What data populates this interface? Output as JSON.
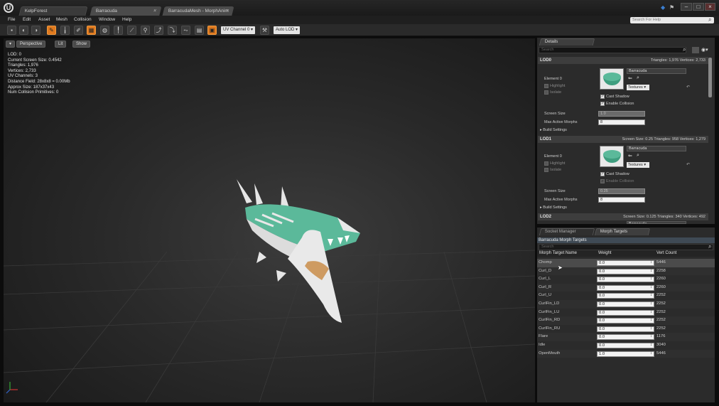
{
  "tabs": [
    {
      "label": "KelpForest"
    },
    {
      "label": "Barracuda"
    },
    {
      "label": "BarracudaMesh - MorphAnim"
    }
  ],
  "menu": [
    "File",
    "Edit",
    "Asset",
    "Mesh",
    "Collision",
    "Window",
    "Help"
  ],
  "search_help": {
    "placeholder": "Search For Help"
  },
  "toolbar": {
    "uv_channel": "UV Channel 0 ▾",
    "lod": "Auto LOD ▾"
  },
  "viewport": {
    "buttons": {
      "perspective": "Perspective",
      "lit": "Lit",
      "show": "Show"
    },
    "stats": [
      "LOD:  0",
      "Current Screen Size:  0.4542",
      "Triangles:  1,976",
      "Vertices:  2,733",
      "UV Channels:  3",
      "Distance Field:  28x8x8 = 0.00Mb",
      "Approx Size:  187x37x43",
      "Num Collision Primitives:  0"
    ]
  },
  "details": {
    "tab": "Details",
    "search_placeholder": "Search",
    "lods": [
      {
        "name": "LOD0",
        "info": "Triangles: 1,976   Vertices: 2,733",
        "element": "Element 0",
        "material": "Barracuda",
        "highlight": "Highlight",
        "isolate": "Isolate",
        "cast_shadow": "Cast Shadow",
        "enable_collision": "Enable Collision",
        "textures": "Textures ▾",
        "screen_size_label": "Screen Size",
        "screen_size": "1.0",
        "max_morphs_label": "Max Active Morphs",
        "max_morphs": "8",
        "build_settings": "▸ Build Settings"
      },
      {
        "name": "LOD1",
        "info": "Screen Size: 0.25   Triangles: 958   Vertices: 1,279",
        "element": "Element 0",
        "material": "Barracuda",
        "highlight": "Highlight",
        "isolate": "Isolate",
        "cast_shadow": "Cast Shadow",
        "enable_collision": "Enable Collision",
        "textures": "Textures ▾",
        "screen_size_label": "Screen Size",
        "screen_size": "0.25",
        "max_morphs_label": "Max Active Morphs",
        "max_morphs": "8",
        "build_settings": "▸ Build Settings"
      },
      {
        "name": "LOD2",
        "info": "Screen Size: 0.125   Triangles: 340   Vertices: 492",
        "material": "Barracuda"
      }
    ]
  },
  "morph_panel": {
    "tabs": {
      "socket": "Socket Manager",
      "morph": "Morph Targets"
    },
    "title": "Barracuda Morph Targets",
    "search_placeholder": "Search",
    "columns": {
      "name": "Morph Target Name",
      "weight": "Weight",
      "vert": "Vert Count"
    },
    "rows": [
      {
        "name": "Chomp",
        "weight": "0.0",
        "vert": "5446"
      },
      {
        "name": "Curl_D",
        "weight": "0.0",
        "vert": "2258"
      },
      {
        "name": "Curl_L",
        "weight": "0.0",
        "vert": "2260"
      },
      {
        "name": "Curl_R",
        "weight": "0.0",
        "vert": "2260"
      },
      {
        "name": "Curl_U",
        "weight": "0.0",
        "vert": "2252"
      },
      {
        "name": "CurlFin_LD",
        "weight": "0.0",
        "vert": "2252"
      },
      {
        "name": "CurlFin_LU",
        "weight": "0.0",
        "vert": "2252"
      },
      {
        "name": "CurlFin_RD",
        "weight": "0.0",
        "vert": "2252"
      },
      {
        "name": "CurlFin_RU",
        "weight": "0.0",
        "vert": "2252"
      },
      {
        "name": "Flare",
        "weight": "0.0",
        "vert": "1176"
      },
      {
        "name": "Idle",
        "weight": "0.0",
        "vert": "3040"
      },
      {
        "name": "OpenMouth",
        "weight": "1.0",
        "vert": "5446"
      }
    ]
  },
  "colors": {
    "accent": "#e07a1f",
    "mesh_green": "#5bb99a",
    "header_blue": "#3f4a55"
  }
}
